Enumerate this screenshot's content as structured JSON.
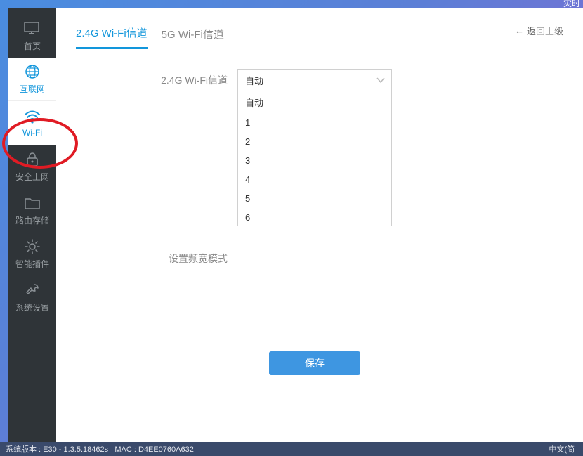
{
  "topbar": {
    "right_partial": "灾时"
  },
  "sidebar": {
    "items": [
      {
        "label": "首页",
        "icon": "monitor"
      },
      {
        "label": "互联网",
        "icon": "globe"
      },
      {
        "label": "Wi-Fi",
        "icon": "wifi"
      },
      {
        "label": "安全上网",
        "icon": "lock"
      },
      {
        "label": "路由存储",
        "icon": "folder"
      },
      {
        "label": "智能插件",
        "icon": "sun"
      },
      {
        "label": "系统设置",
        "icon": "wrench"
      }
    ]
  },
  "tabs": {
    "tab1": "2.4G Wi-Fi信道",
    "tab2": "5G Wi-Fi信道"
  },
  "back_link": "返回上级",
  "form": {
    "channel_label": "2.4G Wi-Fi信道",
    "channel_selected": "自动",
    "channel_options": [
      "自动",
      "1",
      "2",
      "3",
      "4",
      "5",
      "6"
    ],
    "bandwidth_label": "设置频宽模式",
    "save_label": "保存"
  },
  "footer": {
    "version_prefix": "系统版本 : ",
    "version_value": "E30 - 1.3.5.18462s",
    "mac_prefix": "MAC : ",
    "mac_value": "D4EE0760A632",
    "lang": "中文(简"
  }
}
